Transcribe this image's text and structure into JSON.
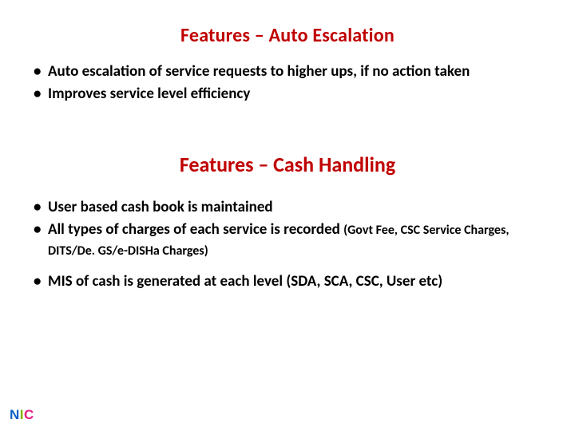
{
  "colors": {
    "heading": "#C00000",
    "body": "#000000"
  },
  "section1": {
    "title": "Features – Auto Escalation",
    "bullets": [
      "Auto escalation of service requests to higher ups, if no action taken",
      "Improves service level efficiency"
    ]
  },
  "section2": {
    "title": "Features – Cash Handling",
    "bullets": [
      {
        "text": "User based cash book is maintained"
      },
      {
        "text": "All types of charges of each service is recorded",
        "sub": "(Govt Fee, CSC Service Charges, DITS/De. GS/e-DISHa Charges)"
      },
      {
        "text": "MIS of cash is generated at each level (SDA, SCA, CSC, User etc)"
      }
    ]
  },
  "logo": {
    "n": "N",
    "i": "I",
    "c": "C"
  }
}
